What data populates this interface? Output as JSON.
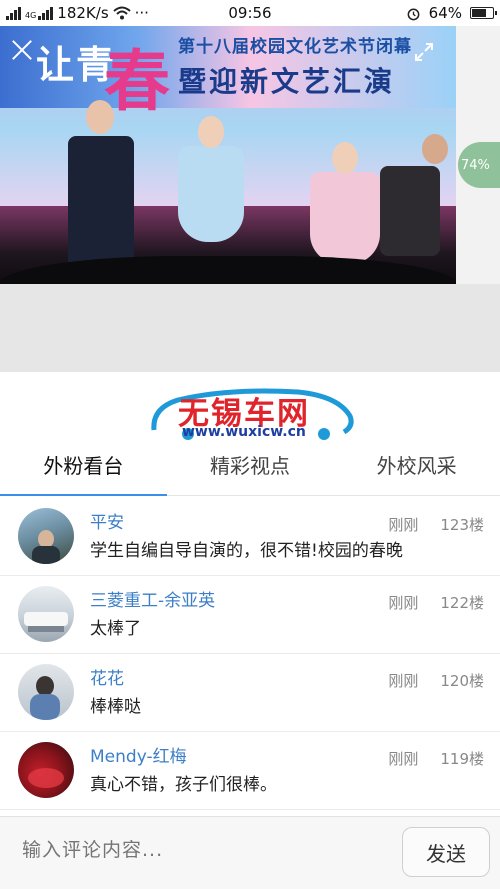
{
  "status_bar": {
    "signal": "2",
    "network": "4G",
    "speed": "182K/s",
    "more": "···",
    "time": "09:56",
    "battery": "64%"
  },
  "video": {
    "banner_left": "让青",
    "banner_big": "春",
    "banner_line1": "第十八届校园文化艺术节闭幕",
    "banner_line2": "暨迎新文艺汇演"
  },
  "floating_badge": "74%",
  "logo": {
    "name": "无锡车网",
    "url": "www.wuxicw.cn"
  },
  "tabs": [
    {
      "label": "外粉看台"
    },
    {
      "label": "精彩视点"
    },
    {
      "label": "外校风采"
    }
  ],
  "comments": [
    {
      "user": "平安",
      "time": "刚刚",
      "floor": "123楼",
      "text": "学生自编自导自演的，很不错!校园的春晚"
    },
    {
      "user": "三菱重工-余亚英",
      "time": "刚刚",
      "floor": "122楼",
      "text": "太棒了"
    },
    {
      "user": "花花",
      "time": "刚刚",
      "floor": "120楼",
      "text": "棒棒哒"
    },
    {
      "user": "Mendy-红梅",
      "time": "刚刚",
      "floor": "119楼",
      "text": "真心不错，孩子们很棒。"
    }
  ],
  "comment_input": {
    "placeholder": "输入评论内容..."
  },
  "send_label": "发送",
  "colors": {
    "accent": "#3d8ee8",
    "username": "#3d7fc6",
    "logo_red": "#e0242c",
    "logo_blue": "#1c3fa0"
  }
}
